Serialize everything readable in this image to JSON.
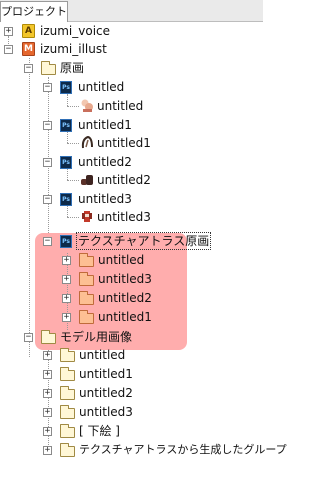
{
  "tab": {
    "label": "プロジェクト"
  },
  "tree": {
    "voice": {
      "label": "izumi_voice"
    },
    "illust": {
      "label": "izumi_illust"
    },
    "genga": {
      "label": "原画"
    },
    "untitled": {
      "label": "untitled",
      "child": "untitled"
    },
    "untitled1": {
      "label": "untitled1",
      "child": "untitled1"
    },
    "untitled2": {
      "label": "untitled2",
      "child": "untitled2"
    },
    "untitled3": {
      "label": "untitled3",
      "child": "untitled3"
    },
    "atlas": {
      "label": "テクスチャアトラス原画",
      "children": [
        "untitled",
        "untitled3",
        "untitled2",
        "untitled1"
      ]
    },
    "model": {
      "label": "モデル用画像",
      "children": [
        "untitled",
        "untitled1",
        "untitled2",
        "untitled3",
        "[ 下絵 ]",
        "テクスチャアトラスから生成したグループ"
      ]
    }
  },
  "highlight_color": "#ffadad"
}
